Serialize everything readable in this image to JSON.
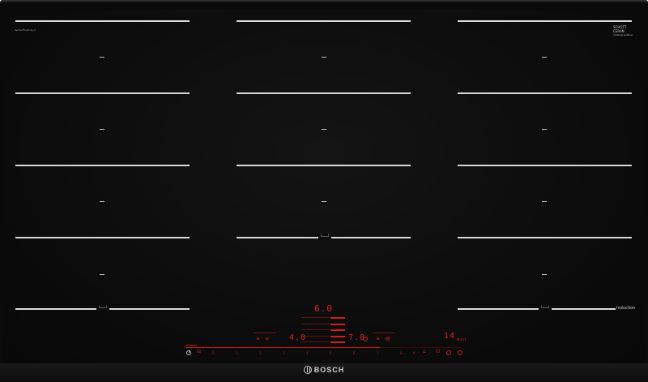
{
  "brand": {
    "name": "BOSCH",
    "icon": "bosch-logo-icon"
  },
  "glass": {
    "manufacturer_small": "PerfectFlexInduct",
    "schott_logo": [
      "SCHOTT",
      "CERAN",
      "cooking surface"
    ],
    "flex_marker": "└──┘",
    "induction_label": "Induction",
    "zone_dash": "—"
  },
  "controls": {
    "power_icon": "power-icon",
    "lock_icon": "lock-icon",
    "timer_display": "6.0",
    "left_power_level": "4.0",
    "center_power_level": "7.0",
    "right_power_level": "14",
    "right_unit": "min",
    "slider_scale": [
      "0",
      "1",
      "2",
      "3",
      "4",
      "5",
      "6",
      "7",
      "8",
      "9"
    ],
    "boost_icon": "boost-icon",
    "timer_icon": "timer-icon",
    "favorite_icon": "favorite-icon",
    "settings_icon": "settings-icon",
    "accent_red": "#e11e1e",
    "display_red": "#c81a1a"
  }
}
